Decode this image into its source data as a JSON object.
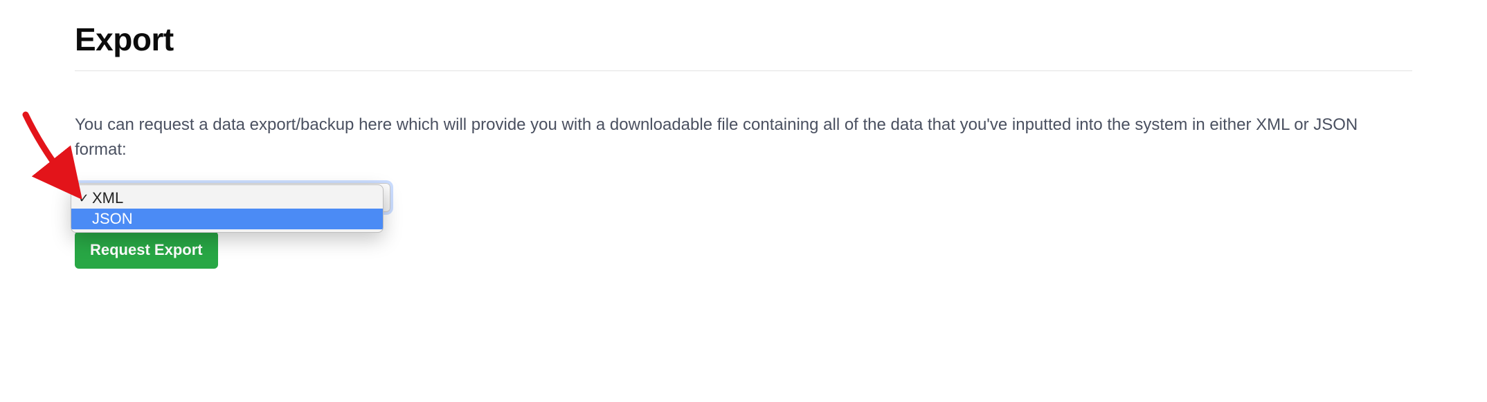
{
  "page_title": "Export",
  "description": "You can request a data export/backup here which will provide you with a downloadable file containing all of the data that you've inputted into the system in either XML or JSON format:",
  "format_select": {
    "selected": "XML",
    "highlighted": "JSON",
    "options": [
      "XML",
      "JSON"
    ]
  },
  "request_button_label": "Request Export",
  "checkmark_glyph": "✓"
}
